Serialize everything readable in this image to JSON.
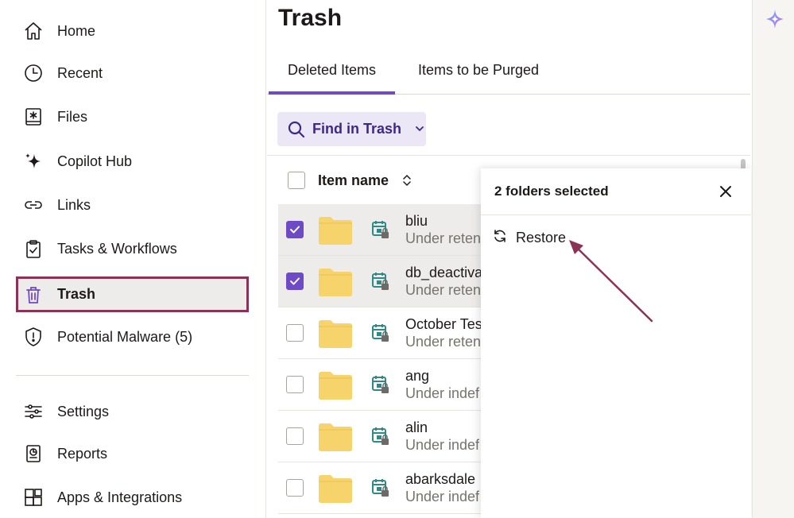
{
  "sidebar": {
    "items": [
      {
        "label": "Home",
        "icon": "home-icon"
      },
      {
        "label": "Recent",
        "icon": "clock-icon"
      },
      {
        "label": "Files",
        "icon": "files-icon"
      },
      {
        "label": "Copilot Hub",
        "icon": "sparkle-icon"
      },
      {
        "label": "Links",
        "icon": "link-icon"
      },
      {
        "label": "Tasks & Workflows",
        "icon": "clipboard-icon"
      },
      {
        "label": "Trash",
        "icon": "trash-icon",
        "active": true
      },
      {
        "label": "Potential Malware (5)",
        "icon": "shield-alert-icon"
      },
      {
        "label": "Settings",
        "icon": "sliders-icon"
      },
      {
        "label": "Reports",
        "icon": "reports-icon"
      },
      {
        "label": "Apps & Integrations",
        "icon": "apps-icon"
      }
    ]
  },
  "main": {
    "title": "Trash",
    "tabs": [
      {
        "label": "Deleted Items",
        "active": true
      },
      {
        "label": "Items to be Purged",
        "active": false
      }
    ],
    "find_button": "Find in Trash",
    "table": {
      "header": {
        "item_name": "Item name"
      },
      "rows": [
        {
          "name": "bliu",
          "status": "Under reten",
          "selected": true
        },
        {
          "name": "db_deactiva",
          "status": "Under reten",
          "selected": true
        },
        {
          "name": "October Tes",
          "status": "Under reten",
          "selected": false
        },
        {
          "name": "ang",
          "status": "Under indef",
          "selected": false
        },
        {
          "name": "alin",
          "status": "Under indef",
          "selected": false
        },
        {
          "name": "abarksdale",
          "status": "Under indef",
          "selected": false
        }
      ]
    }
  },
  "selection_panel": {
    "title": "2 folders selected",
    "restore_label": "Restore"
  },
  "colors": {
    "accent": "#6f4ac7",
    "active_outline": "#8c3355",
    "folder": "#f7d36b",
    "retention_icon": "#2e8a86",
    "annotation_arrow": "#8c3355"
  }
}
